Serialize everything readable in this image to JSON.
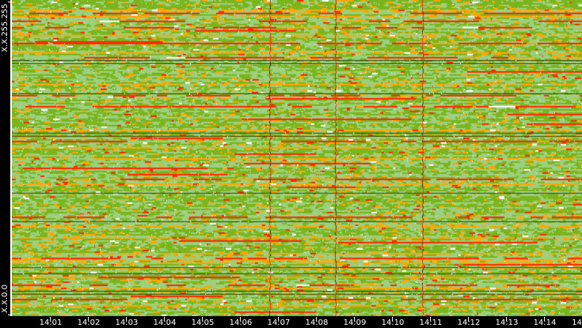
{
  "chart_data": {
    "type": "heatmap",
    "title": "",
    "xlabel": "",
    "ylabel": "",
    "x_tick_labels": [
      "14:01",
      "14:02",
      "14:03",
      "14:04",
      "14:05",
      "14:06",
      "14:07",
      "14:08",
      "14:09",
      "14:10",
      "14:11",
      "14:12",
      "14:13",
      "14:14",
      "14"
    ],
    "y_tick_labels": [
      "X.X.255.255",
      "X.X.0.0"
    ],
    "x_range": [
      "14:00",
      "14:14"
    ],
    "y_range": [
      "X.X.0.0",
      "X.X.255.255"
    ],
    "color_scale": [
      "#ffffff",
      "#9ccf7f",
      "#7ab51d",
      "#ffa500",
      "#ff2a00"
    ],
    "highlighted_times": [
      "14:06:50",
      "14:08:30",
      "14:10:45"
    ]
  }
}
